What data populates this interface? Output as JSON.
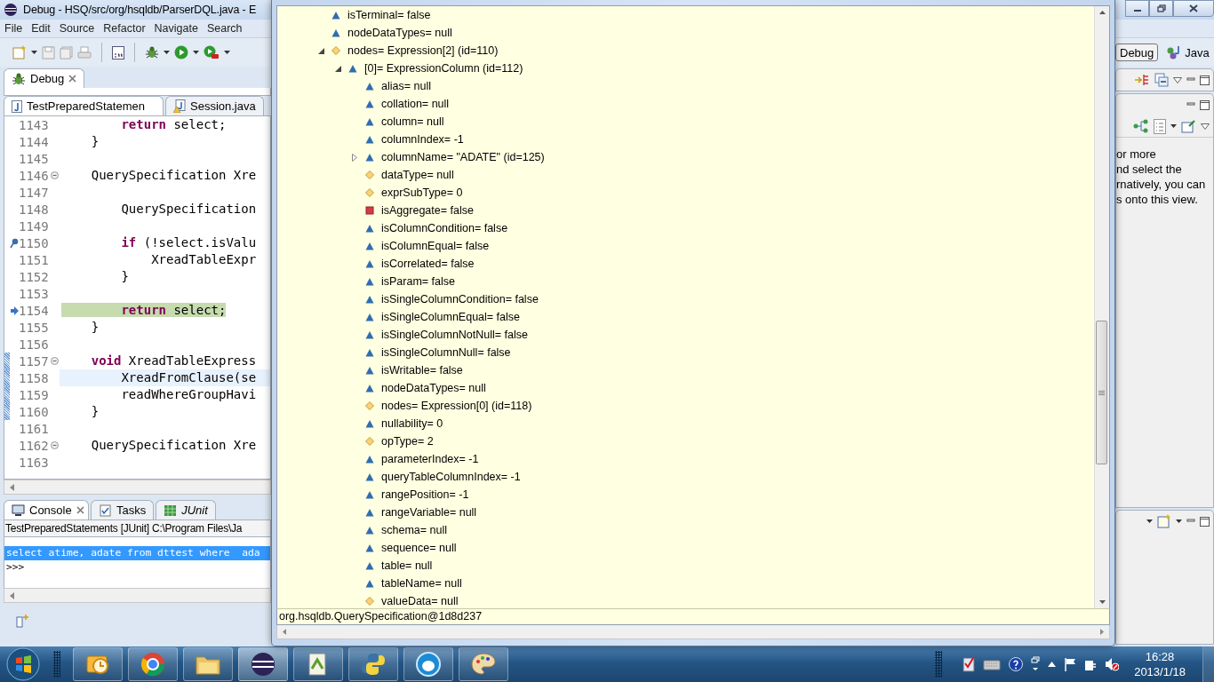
{
  "window": {
    "title": "Debug - HSQ/src/org/hsqldb/ParserDQL.java - E"
  },
  "menu": [
    "File",
    "Edit",
    "Source",
    "Refactor",
    "Navigate",
    "Search"
  ],
  "perspectives": [
    {
      "label": "Debug",
      "selected": true
    },
    {
      "label": "Java",
      "selected": false
    }
  ],
  "debug_view": {
    "tab": "Debug"
  },
  "editor_tabs": [
    {
      "label": "TestPreparedStatemen",
      "selected": true,
      "warning": false
    },
    {
      "label": "Session.java",
      "selected": false,
      "warning": true
    }
  ],
  "code_lines": [
    {
      "number": "1143",
      "code": "        **return** select;",
      "kind": "plain"
    },
    {
      "number": "1144",
      "code": "    }",
      "kind": "plain"
    },
    {
      "number": "1145",
      "kind": "plain"
    },
    {
      "number": "1146",
      "code": "    QuerySpecification Xre",
      "fold": true,
      "kind": "plain"
    },
    {
      "number": "1147",
      "kind": "plain"
    },
    {
      "number": "1148",
      "code": "        QuerySpecification",
      "kind": "plain"
    },
    {
      "number": "1149",
      "kind": "plain"
    },
    {
      "number": "1150",
      "code": "        **if** (!select.isValu",
      "kind": "breakpoint"
    },
    {
      "number": "1151",
      "code": "            XreadTableExpr",
      "kind": "plain"
    },
    {
      "number": "1152",
      "code": "        }",
      "kind": "plain"
    },
    {
      "number": "1153",
      "kind": "plain"
    },
    {
      "number": "1154",
      "code": "        **return** select;",
      "kind": "current"
    },
    {
      "number": "1155",
      "code": "    }",
      "kind": "plain"
    },
    {
      "number": "1156",
      "kind": "plain"
    },
    {
      "number": "1157",
      "code": "    **void** XreadTableExpress",
      "fold": true,
      "range": true,
      "kind": "plain"
    },
    {
      "number": "1158",
      "code": "        XreadFromClause(se",
      "range": true,
      "kind": "cursor"
    },
    {
      "number": "1159",
      "code": "        readWhereGroupHavi",
      "range": true,
      "kind": "plain"
    },
    {
      "number": "1160",
      "code": "    }",
      "range": true,
      "kind": "plain"
    },
    {
      "number": "1161",
      "kind": "plain"
    },
    {
      "number": "1162",
      "code": "    QuerySpecification Xre",
      "fold": true,
      "kind": "plain"
    },
    {
      "number": "1163",
      "kind": "plain"
    }
  ],
  "console": {
    "tabs": [
      {
        "label": "Console",
        "selected": true
      },
      {
        "label": "Tasks",
        "selected": false
      },
      {
        "label": "JUnit",
        "selected": false
      }
    ],
    "header": "TestPreparedStatements [JUnit] C:\\Program Files\\Ja",
    "lines": [
      {
        "text": "select atime, adate from dttest where  ada",
        "selected": true
      },
      {
        "text": ">>>",
        "selected": false
      }
    ]
  },
  "outline_hint_lines": [
    "or more",
    "nd select the",
    "rnatively, you can",
    "s onto this view."
  ],
  "variables": [
    {
      "label": "isTerminal= false",
      "kind": "public"
    },
    {
      "label": "nodeDataTypes= null",
      "kind": "public"
    },
    {
      "label": "nodes= Expression[2]  (id=110)",
      "kind": "default",
      "expanded": true,
      "children": [
        {
          "label": "[0]= ExpressionColumn  (id=112)",
          "kind": "public",
          "expanded": true,
          "children": [
            {
              "label": "alias= null",
              "kind": "public"
            },
            {
              "label": "collation= null",
              "kind": "public"
            },
            {
              "label": "column= null",
              "kind": "public"
            },
            {
              "label": "columnIndex= -1",
              "kind": "public"
            },
            {
              "label": "columnName= \"ADATE\" (id=125)",
              "kind": "public",
              "expanded": false
            },
            {
              "label": "dataType= null",
              "kind": "default"
            },
            {
              "label": "exprSubType= 0",
              "kind": "default"
            },
            {
              "label": "isAggregate= false",
              "kind": "private"
            },
            {
              "label": "isColumnCondition= false",
              "kind": "public"
            },
            {
              "label": "isColumnEqual= false",
              "kind": "public"
            },
            {
              "label": "isCorrelated= false",
              "kind": "public"
            },
            {
              "label": "isParam= false",
              "kind": "public"
            },
            {
              "label": "isSingleColumnCondition= false",
              "kind": "public"
            },
            {
              "label": "isSingleColumnEqual= false",
              "kind": "public"
            },
            {
              "label": "isSingleColumnNotNull= false",
              "kind": "public"
            },
            {
              "label": "isSingleColumnNull= false",
              "kind": "public"
            },
            {
              "label": "isWritable= false",
              "kind": "public"
            },
            {
              "label": "nodeDataTypes= null",
              "kind": "public"
            },
            {
              "label": "nodes= Expression[0]  (id=118)",
              "kind": "default"
            },
            {
              "label": "nullability= 0",
              "kind": "public"
            },
            {
              "label": "opType= 2",
              "kind": "default"
            },
            {
              "label": "parameterIndex= -1",
              "kind": "public"
            },
            {
              "label": "queryTableColumnIndex= -1",
              "kind": "public"
            },
            {
              "label": "rangePosition= -1",
              "kind": "public"
            },
            {
              "label": "rangeVariable= null",
              "kind": "public"
            },
            {
              "label": "schema= null",
              "kind": "public"
            },
            {
              "label": "sequence= null",
              "kind": "public"
            },
            {
              "label": "table= null",
              "kind": "public"
            },
            {
              "label": "tableName= null",
              "kind": "public"
            },
            {
              "label": "valueData= null",
              "kind": "default"
            }
          ]
        }
      ]
    }
  ],
  "detail": "org.hsqldb.QuerySpecification@1d8d237",
  "clock": {
    "time": "16:28",
    "date": "2013/1/18"
  }
}
